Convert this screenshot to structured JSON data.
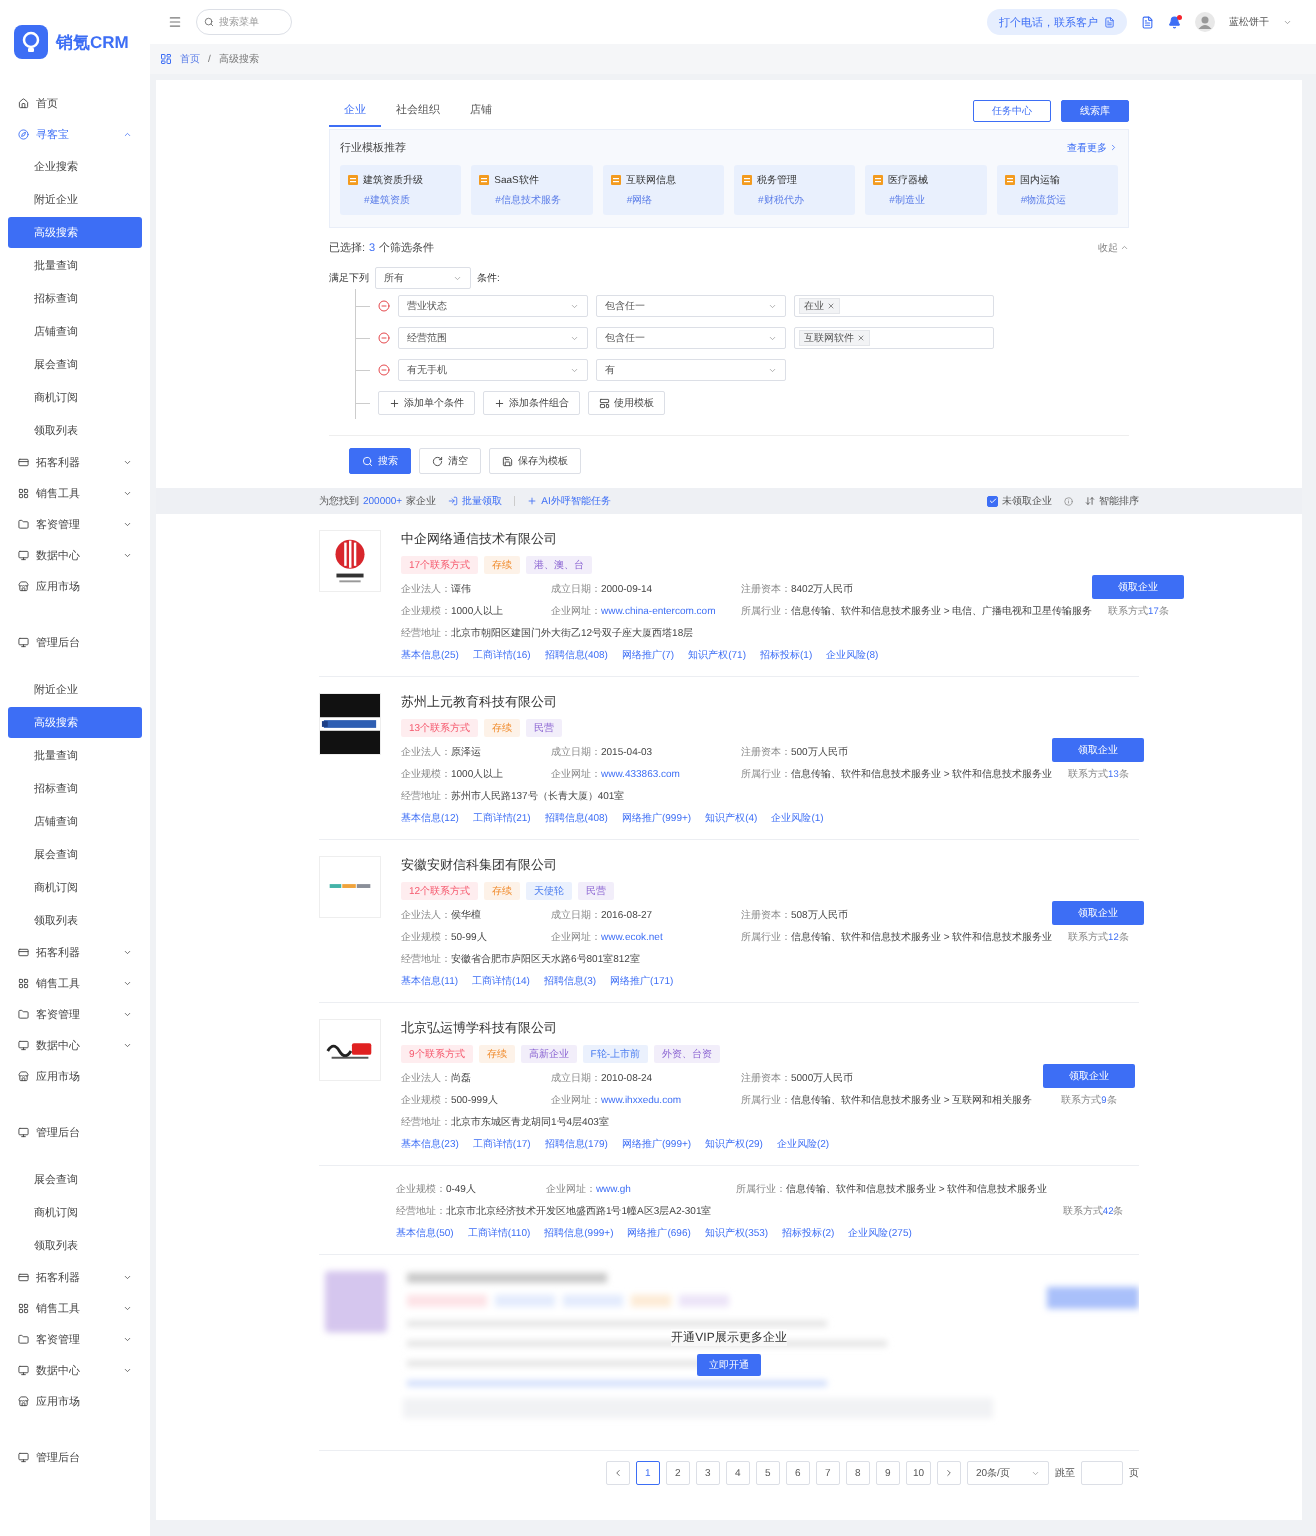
{
  "sidebar": {
    "logo": "销氪CRM",
    "items": [
      {
        "label": "首页",
        "kind": "home"
      },
      {
        "label": "寻客宝",
        "kind": "group",
        "expanded": true
      },
      {
        "label": "企业搜索",
        "kind": "sub",
        "selected": false
      },
      {
        "label": "附近企业",
        "kind": "sub",
        "selected": false
      },
      {
        "label": "高级搜索",
        "kind": "sub",
        "selected": true
      },
      {
        "label": "批量查询",
        "kind": "sub",
        "selected": false
      },
      {
        "label": "招标查询",
        "kind": "sub",
        "selected": false
      },
      {
        "label": "店铺查询",
        "kind": "sub",
        "selected": false
      },
      {
        "label": "展会查询",
        "kind": "sub",
        "selected": false
      },
      {
        "label": "商机订阅",
        "kind": "sub",
        "selected": false
      },
      {
        "label": "领取列表",
        "kind": "sub",
        "selected": false
      },
      {
        "label": "拓客利器",
        "kind": "group",
        "expanded": false
      },
      {
        "label": "销售工具",
        "kind": "group",
        "expanded": false
      },
      {
        "label": "客资管理",
        "kind": "group",
        "expanded": false
      },
      {
        "label": "数据中心",
        "kind": "group",
        "expanded": false
      },
      {
        "label": "应用市场",
        "kind": "store"
      },
      {
        "label": "管理后台",
        "kind": "section"
      },
      {
        "label": "附近企业",
        "kind": "sub",
        "selected": false
      },
      {
        "label": "高级搜索",
        "kind": "sub",
        "selected": true
      },
      {
        "label": "批量查询",
        "kind": "sub",
        "selected": false
      },
      {
        "label": "招标查询",
        "kind": "sub",
        "selected": false
      },
      {
        "label": "店铺查询",
        "kind": "sub",
        "selected": false
      },
      {
        "label": "展会查询",
        "kind": "sub",
        "selected": false
      },
      {
        "label": "商机订阅",
        "kind": "sub",
        "selected": false
      },
      {
        "label": "领取列表",
        "kind": "sub",
        "selected": false
      },
      {
        "label": "拓客利器",
        "kind": "group",
        "expanded": false
      },
      {
        "label": "销售工具",
        "kind": "group",
        "expanded": false
      },
      {
        "label": "客资管理",
        "kind": "group",
        "expanded": false
      },
      {
        "label": "数据中心",
        "kind": "group",
        "expanded": false
      },
      {
        "label": "应用市场",
        "kind": "store"
      },
      {
        "label": "管理后台",
        "kind": "section"
      },
      {
        "label": "展会查询",
        "kind": "sub",
        "selected": false
      },
      {
        "label": "商机订阅",
        "kind": "sub",
        "selected": false
      },
      {
        "label": "领取列表",
        "kind": "sub",
        "selected": false
      },
      {
        "label": "拓客利器",
        "kind": "group",
        "expanded": false
      },
      {
        "label": "销售工具",
        "kind": "group",
        "expanded": false
      },
      {
        "label": "客资管理",
        "kind": "group",
        "expanded": false
      },
      {
        "label": "数据中心",
        "kind": "group",
        "expanded": false
      },
      {
        "label": "应用市场",
        "kind": "store"
      },
      {
        "label": "管理后台",
        "kind": "section"
      }
    ]
  },
  "topbar": {
    "search_placeholder": "搜索菜单",
    "call_button": "打个电话，联系客户",
    "user": "蓝松饼干",
    "notification_dot": true
  },
  "breadcrumb": {
    "items": [
      "首页",
      "高级搜索"
    ],
    "separator": "/"
  },
  "tabs": [
    {
      "label": "企业",
      "selected": true
    },
    {
      "label": "社会组织",
      "selected": false
    },
    {
      "label": "店铺",
      "selected": false
    }
  ],
  "header_buttons": [
    {
      "label": "任务中心",
      "kind": "outline"
    },
    {
      "label": "线索库",
      "kind": "primary"
    }
  ],
  "templates": {
    "title": "行业模板推荐",
    "more": "查看更多",
    "items": [
      {
        "name": "建筑资质升级",
        "tag": "#建筑资质"
      },
      {
        "name": "SaaS软件",
        "tag": "#信息技术服务"
      },
      {
        "name": "互联网信息",
        "tag": "#网络"
      },
      {
        "name": "税务管理",
        "tag": "#财税代办"
      },
      {
        "name": "医疗器械",
        "tag": "#制造业"
      },
      {
        "name": "国内运输",
        "tag": "#物流货运"
      }
    ]
  },
  "summary": {
    "prefix": "已选择:",
    "count": "3",
    "suffix": "个筛选条件",
    "collapse": "收起"
  },
  "conditions": {
    "lead": "满足下列",
    "match": "所有",
    "tail": "条件:",
    "rows": [
      {
        "field": "营业状态",
        "operator": "包含任一",
        "values": [
          "在业"
        ]
      },
      {
        "field": "经营范围",
        "operator": "包含任一",
        "values": [
          "互联网软件"
        ]
      },
      {
        "field": "有无手机",
        "operator": "有"
      }
    ],
    "add_buttons": [
      {
        "label": "添加单个条件",
        "kind": "single"
      },
      {
        "label": "添加条件组合",
        "kind": "group"
      },
      {
        "label": "使用模板",
        "kind": "template"
      }
    ]
  },
  "actions": [
    {
      "label": "搜索",
      "kind": "search"
    },
    {
      "label": "清空",
      "kind": "clear"
    },
    {
      "label": "保存为模板",
      "kind": "save"
    }
  ],
  "results": {
    "prefix": "为您找到",
    "count": "200000+",
    "suffix": "家企业",
    "bulk": "批量领取",
    "ai_task": "AI外呼智能任务",
    "unclaimed": {
      "label": "未领取企业",
      "checked": true
    },
    "sort": "智能排序"
  },
  "companies": [
    {
      "kind": "full",
      "name": "中企网络通信技术有限公司",
      "tags": [
        {
          "text": "17个联系方式",
          "kind": "contact"
        },
        {
          "text": "存续",
          "kind": "status"
        },
        {
          "text": "港、澳、台",
          "kind": "attribute"
        }
      ],
      "fields": [
        [
          {
            "label": "企业法人：",
            "value": "谭伟"
          },
          {
            "label": "成立日期：",
            "value": "2000-09-14"
          },
          {
            "label": "注册资本：",
            "value": "8402万人民币"
          }
        ],
        [
          {
            "label": "企业规模：",
            "value": "1000人以上"
          },
          {
            "label": "企业网址：",
            "value": "www.china-entercom.com",
            "link": true
          },
          {
            "label": "所属行业：",
            "value": "信息传输、软件和信息技术服务业 > 电信、广播电视和卫星传输服务"
          }
        ],
        [
          {
            "label": "经营地址：",
            "value": "北京市朝阳区建国门外大街乙12号双子座大厦西塔18层"
          }
        ]
      ],
      "links": [
        "基本信息(25)",
        "工商详情(16)",
        "招聘信息(408)",
        "网络推广(7)",
        "知识产权(71)",
        "招标投标(1)",
        "企业风险(8)"
      ],
      "claim": "领取企业",
      "contact": [
        "联系方式",
        "17",
        "条"
      ]
    },
    {
      "kind": "full",
      "name": "苏州上元教育科技有限公司",
      "tags": [
        {
          "text": "13个联系方式",
          "kind": "contact"
        },
        {
          "text": "存续",
          "kind": "status"
        },
        {
          "text": "民营",
          "kind": "attribute"
        }
      ],
      "fields": [
        [
          {
            "label": "企业法人：",
            "value": "原泽运"
          },
          {
            "label": "成立日期：",
            "value": "2015-04-03"
          },
          {
            "label": "注册资本：",
            "value": "500万人民币"
          }
        ],
        [
          {
            "label": "企业规模：",
            "value": "1000人以上"
          },
          {
            "label": "企业网址：",
            "value": "www.433863.com",
            "link": true
          },
          {
            "label": "所属行业：",
            "value": "信息传输、软件和信息技术服务业 > 软件和信息技术服务业"
          }
        ],
        [
          {
            "label": "经营地址：",
            "value": "苏州市人民路137号（长青大厦）401室"
          }
        ]
      ],
      "links": [
        "基本信息(12)",
        "工商详情(21)",
        "招聘信息(408)",
        "网络推广(999+)",
        "知识产权(4)",
        "企业风险(1)"
      ],
      "claim": "领取企业",
      "contact": [
        "联系方式",
        "13",
        "条"
      ]
    },
    {
      "kind": "full",
      "name": "安徽安财信科集团有限公司",
      "tags": [
        {
          "text": "12个联系方式",
          "kind": "contact"
        },
        {
          "text": "存续",
          "kind": "status"
        },
        {
          "text": "天使轮",
          "kind": "funding"
        },
        {
          "text": "民营",
          "kind": "attribute"
        }
      ],
      "fields": [
        [
          {
            "label": "企业法人：",
            "value": "侯华檀"
          },
          {
            "label": "成立日期：",
            "value": "2016-08-27"
          },
          {
            "label": "注册资本：",
            "value": "508万人民币"
          }
        ],
        [
          {
            "label": "企业规模：",
            "value": "50-99人"
          },
          {
            "label": "企业网址：",
            "value": "www.ecok.net",
            "link": true
          },
          {
            "label": "所属行业：",
            "value": "信息传输、软件和信息技术服务业 > 软件和信息技术服务业"
          }
        ],
        [
          {
            "label": "经营地址：",
            "value": "安徽省合肥市庐阳区天水路6号801室812室"
          }
        ]
      ],
      "links": [
        "基本信息(11)",
        "工商详情(14)",
        "招聘信息(3)",
        "网络推广(171)"
      ],
      "claim": "领取企业",
      "contact": [
        "联系方式",
        "12",
        "条"
      ]
    },
    {
      "kind": "full",
      "name": "北京弘运博学科技有限公司",
      "tags": [
        {
          "text": "9个联系方式",
          "kind": "contact"
        },
        {
          "text": "存续",
          "kind": "status"
        },
        {
          "text": "高新企业",
          "kind": "attribute"
        },
        {
          "text": "F轮-上市前",
          "kind": "funding"
        },
        {
          "text": "外资、台资",
          "kind": "attribute"
        }
      ],
      "fields": [
        [
          {
            "label": "企业法人：",
            "value": "尚磊"
          },
          {
            "label": "成立日期：",
            "value": "2010-08-24"
          },
          {
            "label": "注册资本：",
            "value": "5000万人民币"
          }
        ],
        [
          {
            "label": "企业规模：",
            "value": "500-999人"
          },
          {
            "label": "企业网址：",
            "value": "www.ihxxedu.com",
            "link": true
          },
          {
            "label": "所属行业：",
            "value": "信息传输、软件和信息技术服务业 > 互联网和相关服务"
          }
        ],
        [
          {
            "label": "经营地址：",
            "value": "北京市东城区青龙胡同1号4层403室"
          }
        ]
      ],
      "links": [
        "基本信息(23)",
        "工商详情(17)",
        "招聘信息(179)",
        "网络推广(999+)",
        "知识产权(29)",
        "企业风险(2)"
      ],
      "claim": "领取企业",
      "contact": [
        "联系方式",
        "9",
        "条"
      ]
    },
    {
      "kind": "partial",
      "fields": [
        [
          {
            "label": "企业规模：",
            "value": "0-49人"
          },
          {
            "label": "企业网址：",
            "value": "www.gh",
            "link": true
          },
          {
            "label": "所属行业：",
            "value": "信息传输、软件和信息技术服务业 > 软件和信息技术服务业"
          }
        ],
        [
          {
            "label": "经营地址：",
            "value": "北京市北京经济技术开发区地盛西路1号1幢A区3层A2-301室"
          }
        ]
      ],
      "links": [
        "基本信息(50)",
        "工商详情(110)",
        "招聘信息(999+)",
        "网络推广(696)",
        "知识产权(353)",
        "招标投标(2)",
        "企业风险(275)"
      ],
      "contact": [
        "联系方式",
        "42",
        "条"
      ]
    }
  ],
  "vip": {
    "text": "开通VIP展示更多企业",
    "button": "立即开通"
  },
  "pagination": {
    "pages": [
      {
        "label": "1",
        "selected": true
      },
      {
        "label": "2",
        "selected": false
      },
      {
        "label": "3",
        "selected": false
      },
      {
        "label": "4",
        "selected": false
      },
      {
        "label": "5",
        "selected": false
      },
      {
        "label": "6",
        "selected": false
      },
      {
        "label": "7",
        "selected": false
      },
      {
        "label": "8",
        "selected": false
      },
      {
        "label": "9",
        "selected": false
      },
      {
        "label": "10",
        "selected": false
      }
    ],
    "page_size": "20条/页",
    "jump": "跳至",
    "unit": "页"
  }
}
